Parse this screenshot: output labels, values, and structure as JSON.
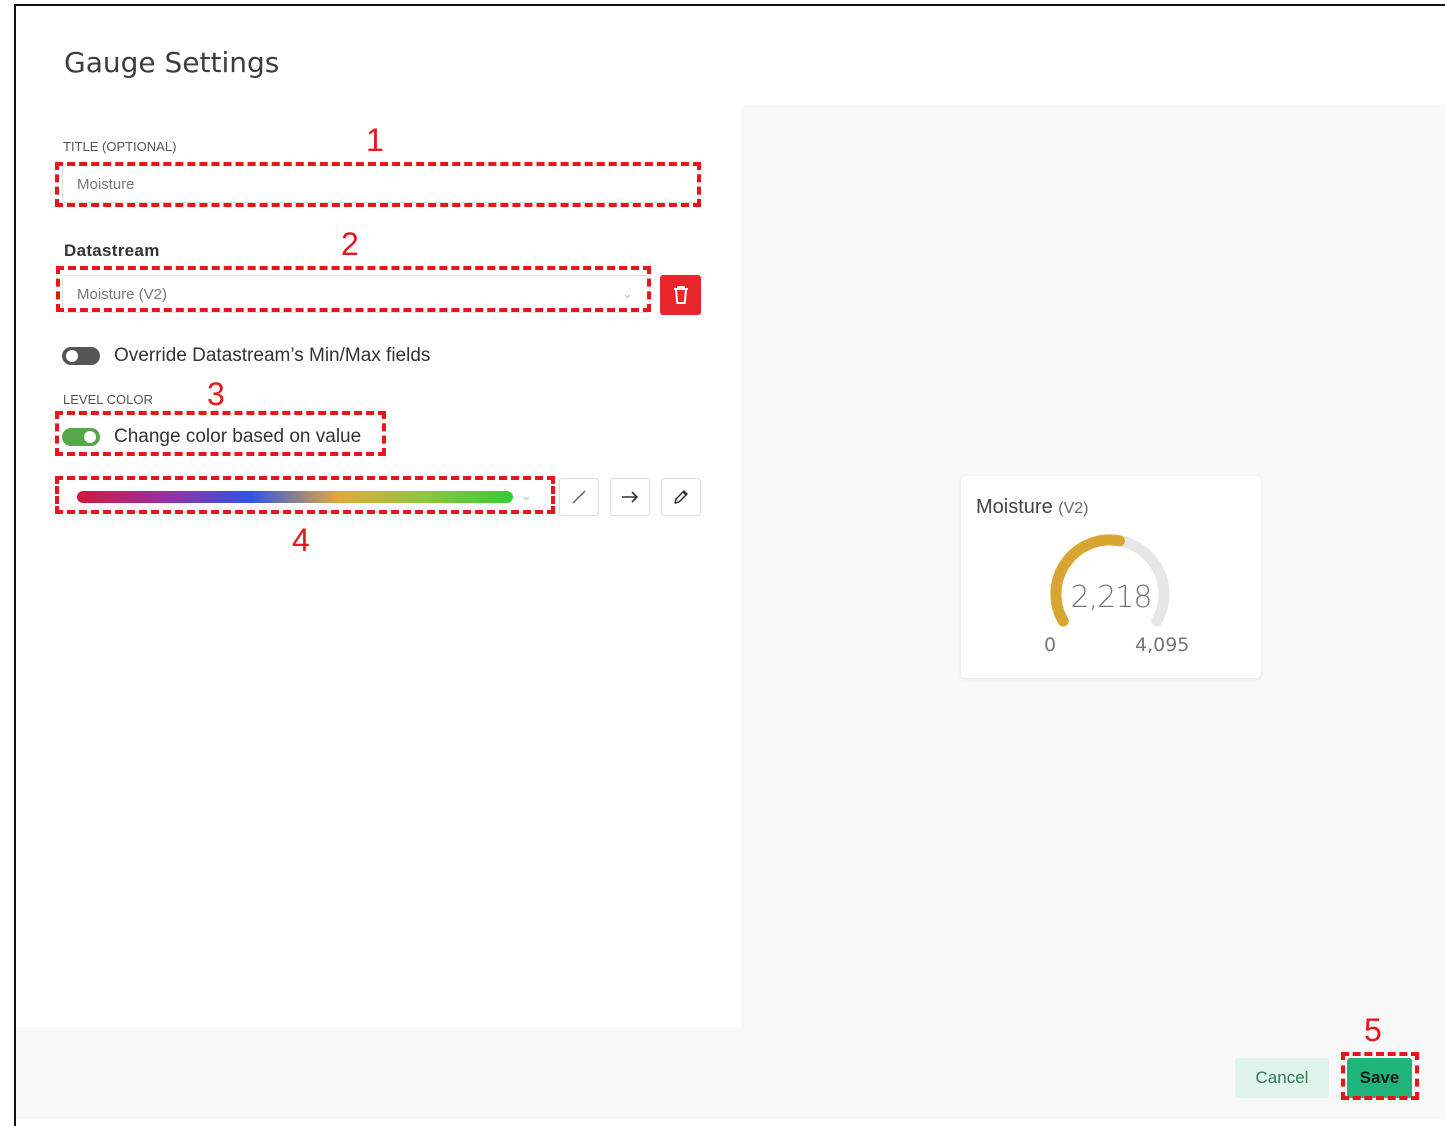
{
  "dialog": {
    "title": "Gauge Settings"
  },
  "form": {
    "title_label": "TITLE (OPTIONAL)",
    "title_value": "Moisture",
    "datastream_label": "Datastream",
    "datastream_value": "Moisture (V2)",
    "override_label": "Override Datastream’s Min/Max fields",
    "override_on": false,
    "level_color_label": "LEVEL COLOR",
    "change_color_label": "Change color based on value",
    "change_color_on": true,
    "gradient_colors": [
      "#d4173e",
      "#9b2ea4",
      "#2e55e8",
      "#e3a93a",
      "#8dc63f",
      "#33cc33"
    ]
  },
  "annotations": [
    "1",
    "2",
    "3",
    "4",
    "5"
  ],
  "preview": {
    "widget_title": "Moisture",
    "widget_pin": "(V2)",
    "value": "2,218",
    "min": "0",
    "max": "4,095",
    "value_fraction": 0.5416,
    "gauge_color": "#d9a531",
    "track_color": "#e6e6e6"
  },
  "footer": {
    "cancel_label": "Cancel",
    "save_label": "Save"
  },
  "colors": {
    "accent_green": "#1fb57a",
    "danger_red": "#e8262c",
    "annotation_red": "#e8151b",
    "toggle_on": "#55a84a",
    "toggle_off": "#555555"
  }
}
